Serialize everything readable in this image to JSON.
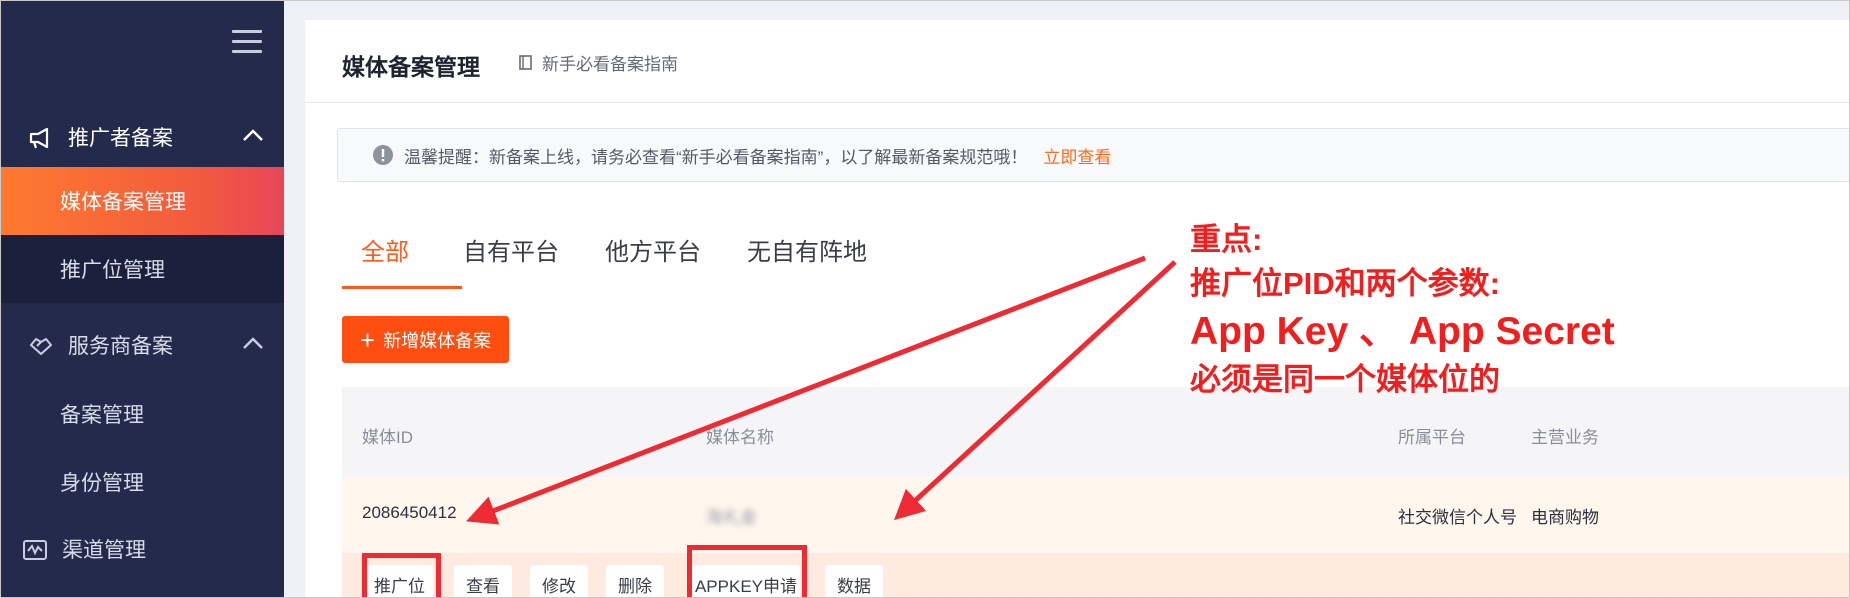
{
  "sidebar": {
    "groups": [
      {
        "label": "推广者备案",
        "icon": "megaphone-icon"
      },
      {
        "label": "服务商备案",
        "icon": "handshake-icon"
      },
      {
        "label": "渠道管理",
        "icon": "channel-icon"
      }
    ],
    "items": [
      {
        "label": "媒体备案管理"
      },
      {
        "label": "推广位管理"
      },
      {
        "label": "备案管理"
      },
      {
        "label": "身份管理"
      }
    ]
  },
  "header": {
    "title": "媒体备案管理",
    "guide_link": "新手必看备案指南"
  },
  "notice": {
    "text": "温馨提醒：新备案上线，请务必查看“新手必看备案指南”，以了解最新备案规范哦！",
    "action": "立即查看"
  },
  "tabs": [
    {
      "label": "全部"
    },
    {
      "label": "自有平台"
    },
    {
      "label": "他方平台"
    },
    {
      "label": "无自有阵地"
    }
  ],
  "add_button": {
    "label": "新增媒体备案"
  },
  "table": {
    "headers": [
      "媒体ID",
      "媒体名称",
      "所属平台",
      "主营业务"
    ],
    "row": {
      "media_id": "2086450412",
      "media_name": "淘礼金",
      "platform": "社交微信个人号",
      "business": "电商购物"
    },
    "actions": [
      "推广位",
      "查看",
      "修改",
      "删除",
      "APPKEY申请",
      "数据"
    ]
  },
  "annotation": {
    "line1": "重点:",
    "line2": "推广位PID和两个参数:",
    "line3": "App Key 、 App Secret",
    "line4": "必须是同一个媒体位的"
  },
  "colors": {
    "sidebar_bg": "#232a4b",
    "accent": "#ff5a1c",
    "annotation_red": "#f21d1d"
  }
}
